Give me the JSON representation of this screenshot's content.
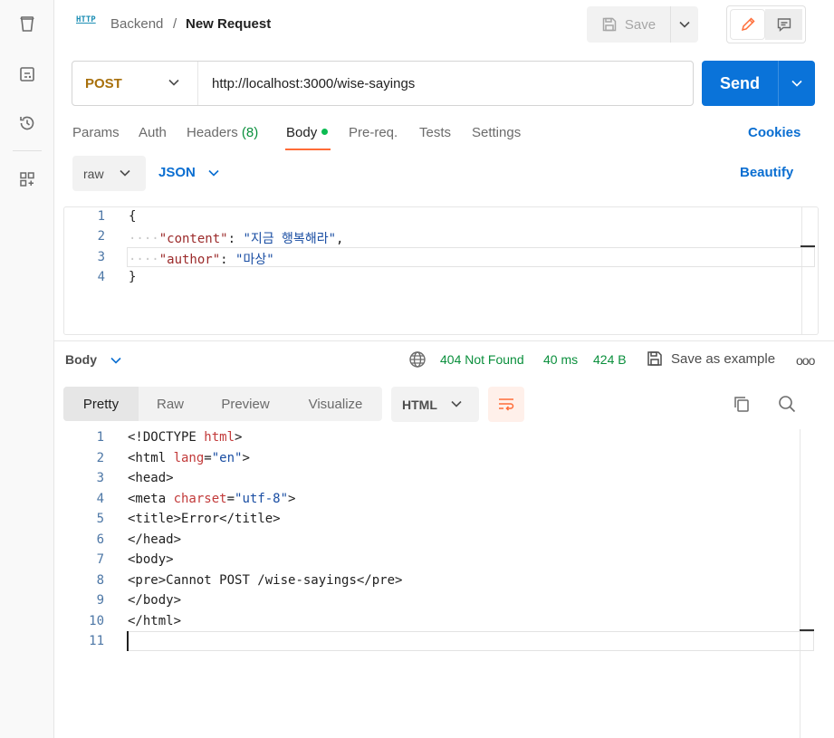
{
  "sidebar": {
    "icons": [
      "collections-icon",
      "environments-icon",
      "history-icon",
      "add-workspace-icon"
    ]
  },
  "header": {
    "protocol_icon_text": "HTTP",
    "breadcrumb_parent": "Backend",
    "breadcrumb_sep": "/",
    "breadcrumb_current": "New Request",
    "save_label": "Save"
  },
  "request": {
    "method": "POST",
    "url": "http://localhost:3000/wise-sayings",
    "send_label": "Send"
  },
  "tabs": {
    "params": "Params",
    "auth": "Auth",
    "headers": "Headers",
    "headers_count": "(8)",
    "body": "Body",
    "prereq": "Pre-req.",
    "tests": "Tests",
    "settings": "Settings",
    "cookies": "Cookies"
  },
  "body_options": {
    "mode": "raw",
    "language": "JSON",
    "beautify": "Beautify"
  },
  "request_body": {
    "line_numbers": [
      "1",
      "2",
      "3",
      "4"
    ],
    "open_brace": "{",
    "indent": "····",
    "content_key": "\"content\"",
    "content_value": "\"지금 행복해라\"",
    "author_key": "\"author\"",
    "author_value": "\"마상\"",
    "close_brace": "}"
  },
  "response": {
    "section_label": "Body",
    "status": "404 Not Found",
    "time": "40 ms",
    "size": "424 B",
    "save_example": "Save as example",
    "more": "ooo",
    "view_tabs": [
      "Pretty",
      "Raw",
      "Preview",
      "Visualize"
    ],
    "format": "HTML",
    "line_numbers": [
      "1",
      "2",
      "3",
      "4",
      "5",
      "6",
      "7",
      "8",
      "9",
      "10",
      "11"
    ],
    "lines": {
      "l1_a": "<!DOCTYPE ",
      "l1_b": "html",
      "l1_c": ">",
      "l2_a": "<html ",
      "l2_b": "lang",
      "l2_c": "=",
      "l2_d": "\"en\"",
      "l2_e": ">",
      "l3": "<head>",
      "l4_a": "<meta ",
      "l4_b": "charset",
      "l4_c": "=",
      "l4_d": "\"utf-8\"",
      "l4_e": ">",
      "l5_a": "<title>",
      "l5_b": "Error",
      "l5_c": "</title>",
      "l6": "</head>",
      "l7": "<body>",
      "l8_a": "<pre>",
      "l8_b": "Cannot POST /wise-sayings",
      "l8_c": "</pre>",
      "l9": "</body>",
      "l10": "</html>"
    }
  },
  "colors": {
    "accent": "#ff6c37",
    "send": "#0a73d9",
    "link": "#0a6ed1",
    "status": "#0a8f3c",
    "method": "#a8700c"
  }
}
